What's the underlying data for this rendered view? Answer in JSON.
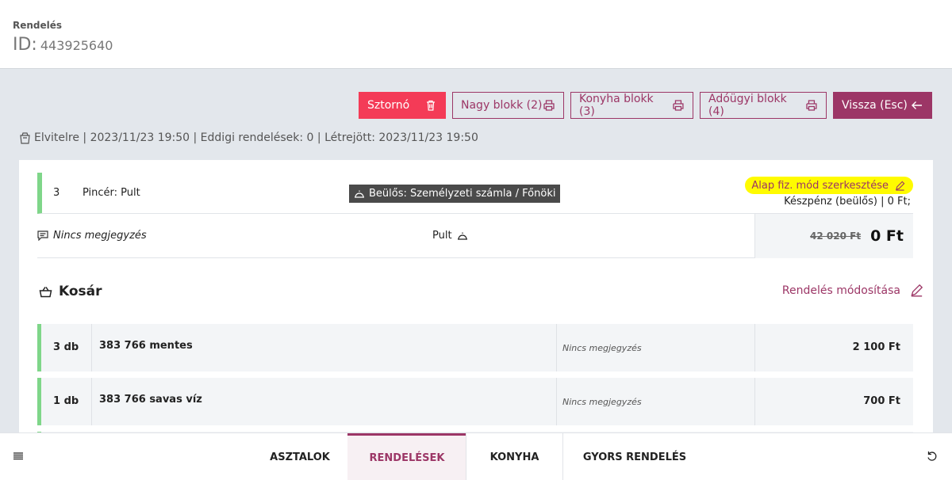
{
  "header": {
    "title": "Rendelés",
    "id_label": "ID:",
    "id_value": "443925640"
  },
  "toolbar": {
    "storno": "Sztornó",
    "nagy_blokk": "Nagy blokk (2)",
    "konyha_blokk": "Konyha blokk (3)",
    "adougyi_blokk": "Adóügyi blokk (4)",
    "vissza": "Vissza (Esc)"
  },
  "info": {
    "text": "Elvitelre | 2023/11/23 19:50 | Eddigi rendelések: 0 | Létrejött: 2023/11/23 19:50"
  },
  "order": {
    "table_number": "3",
    "waiter": "Pincér: Pult",
    "payment_badge": "Beülős: Személyzeti számla / Főnöki",
    "payment_mode_link": "Alap fiz. mód szerkesztése",
    "payment_detail": "Készpénz (beülős) | 0 Ft;",
    "note": "Nincs megjegyzés",
    "location": "Pult",
    "old_total": "42 020 Ft",
    "total": "0 Ft"
  },
  "basket": {
    "title": "Kosár",
    "modify_link": "Rendelés módosítása",
    "items": [
      {
        "qty": "3 db",
        "name": "383 766 mentes",
        "note": "Nincs megjegyzés",
        "price": "2 100 Ft"
      },
      {
        "qty": "1 db",
        "name": "383 766 savas víz",
        "note": "Nincs megjegyzés",
        "price": "700 Ft"
      }
    ]
  },
  "nav": {
    "tabs": [
      "ASZTALOK",
      "RENDELÉSEK",
      "KONYHA",
      "GYORS RENDELÉS"
    ],
    "active_tab": "RENDELÉSEK"
  },
  "colors": {
    "accent": "#9c3666",
    "danger": "#f43b57",
    "status_green": "#7fd689",
    "highlight": "#fffb00"
  },
  "icons": [
    "trash-icon",
    "printer-icon",
    "arrow-left-icon",
    "takeaway-icon",
    "service-bell-icon",
    "pencil-icon",
    "comment-icon",
    "basket-icon",
    "menu-icon",
    "refresh-icon"
  ]
}
